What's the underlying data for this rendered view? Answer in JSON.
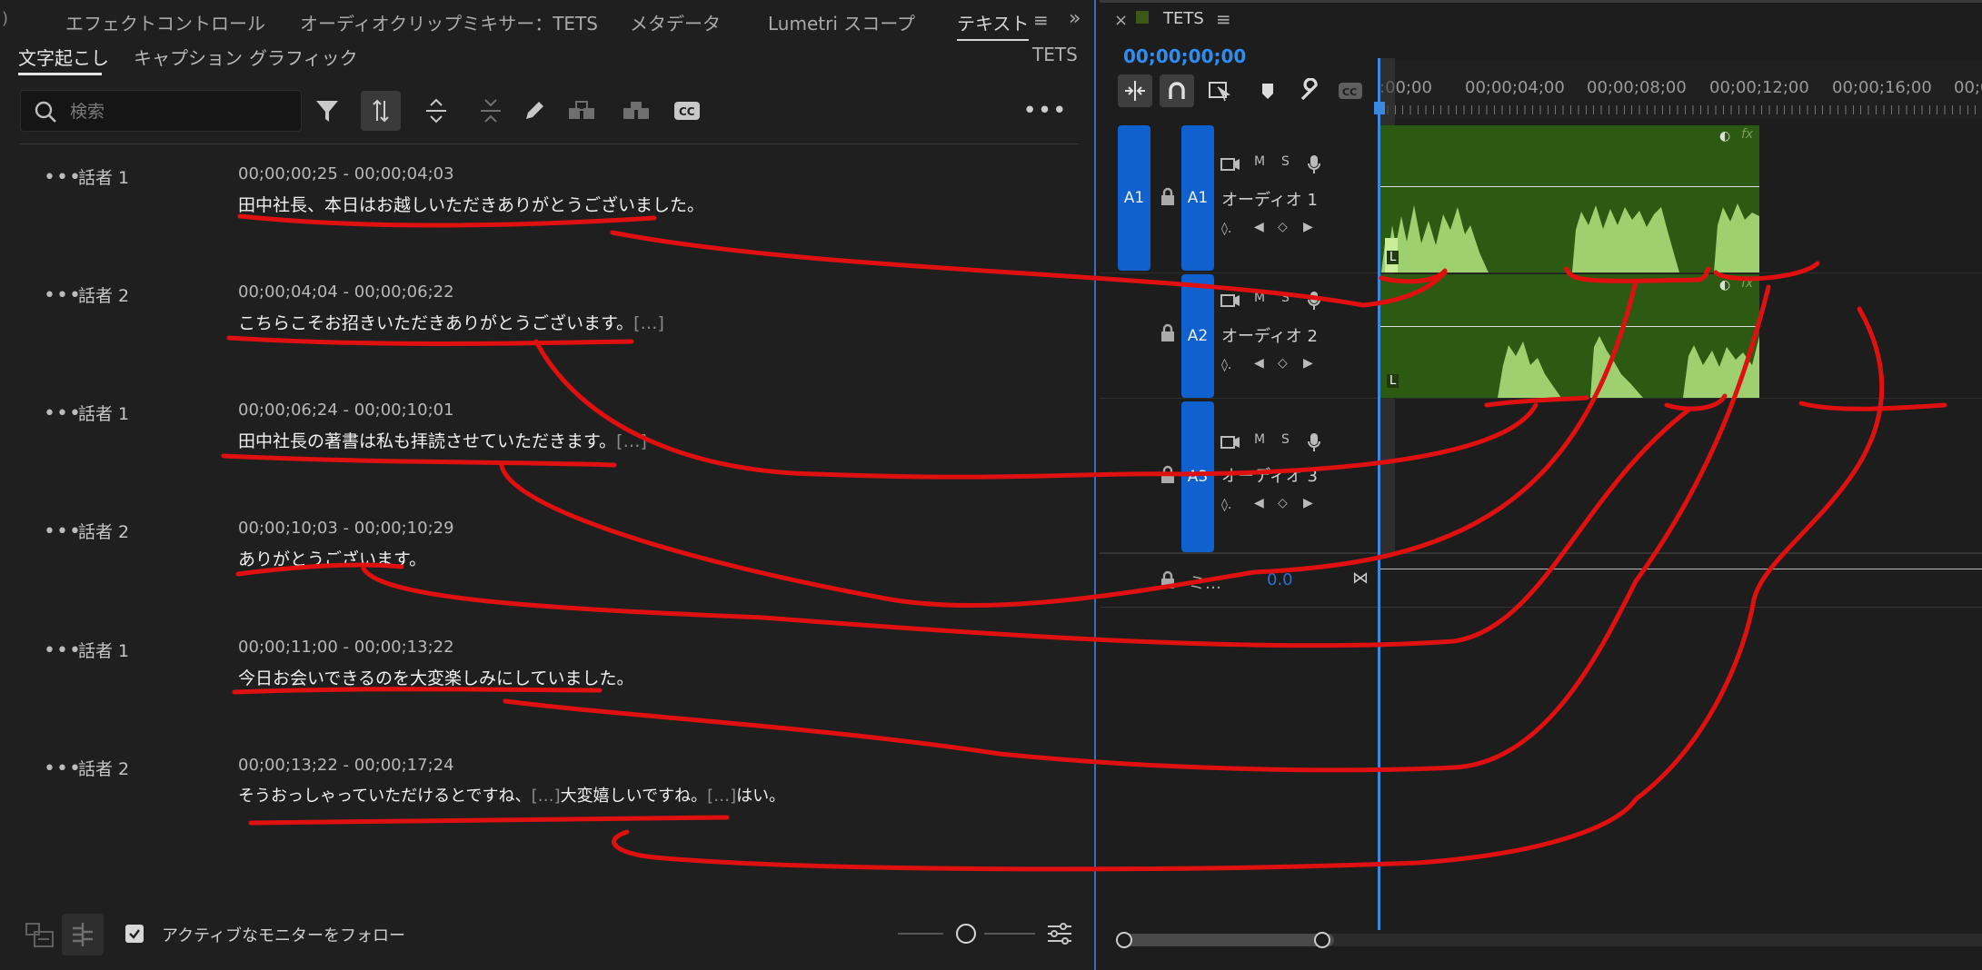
{
  "panel_tabs": [
    "エフェクトコントロール",
    "オーディオクリップミキサー：TETS",
    "メタデータ",
    "Lumetri スコープ",
    "テキスト"
  ],
  "sub_tabs": [
    "文字起こし",
    "キャプション",
    "グラフィック"
  ],
  "sequence_name": "TETS",
  "search": {
    "placeholder": "検索"
  },
  "entries": [
    {
      "speaker": "話者 1",
      "timecode": "00;00;00;25 - 00;00;04;03",
      "text": "田中社長、本日はお越しいただきありがとうございました。",
      "ellipsis": ""
    },
    {
      "speaker": "話者 2",
      "timecode": "00;00;04;04 - 00;00;06;22",
      "text": "こちらこそお招きいただきありがとうございます。",
      "ellipsis": "[…]"
    },
    {
      "speaker": "話者 1",
      "timecode": "00;00;06;24 - 00;00;10;01",
      "text": "田中社長の著書は私も拝読させていただきます。",
      "ellipsis": "[…]"
    },
    {
      "speaker": "話者 2",
      "timecode": "00;00;10;03 - 00;00;10;29",
      "text": "ありがとうございます。",
      "ellipsis": ""
    },
    {
      "speaker": "話者 1",
      "timecode": "00;00;11;00 - 00;00;13;22",
      "text": "今日お会いできるのを大変楽しみにしていました。",
      "ellipsis": ""
    },
    {
      "speaker": "話者 2",
      "timecode": "00;00;13;22 - 00;00;17;24",
      "text_parts": [
        "そうおっしゃっていただけるとですね、",
        "[…]",
        "大変嬉しいですね。",
        "[…]",
        "はい。"
      ]
    }
  ],
  "footer": {
    "follow_label": "アクティブなモニターをフォロー",
    "follow_checked": true
  },
  "timeline": {
    "title": "TETS",
    "close_label": "×",
    "current_time": "00;00;00;00",
    "ruler": [
      ":00;00",
      "00;00;04;00",
      "00;00;08;00",
      "00;00;12;00",
      "00;00;16;00",
      "00;0"
    ],
    "tracks": [
      {
        "src": "A1",
        "id": "A1",
        "name": "オーディオ 1"
      },
      {
        "src": "",
        "id": "A2",
        "name": "オーディオ 2"
      },
      {
        "src": "",
        "id": "A3",
        "name": "オーディオ 3"
      }
    ],
    "mix": {
      "label": "ミ…",
      "value": "0.0"
    },
    "track_buttons": {
      "m": "M",
      "s": "S"
    },
    "clip_channel": "L",
    "fx_label": "fx"
  },
  "colors": {
    "accent": "#1060d0",
    "clip": "#2d5a12",
    "wave": "#9ed070",
    "annotation": "#e01010",
    "timecode": "#2f8cf0"
  }
}
